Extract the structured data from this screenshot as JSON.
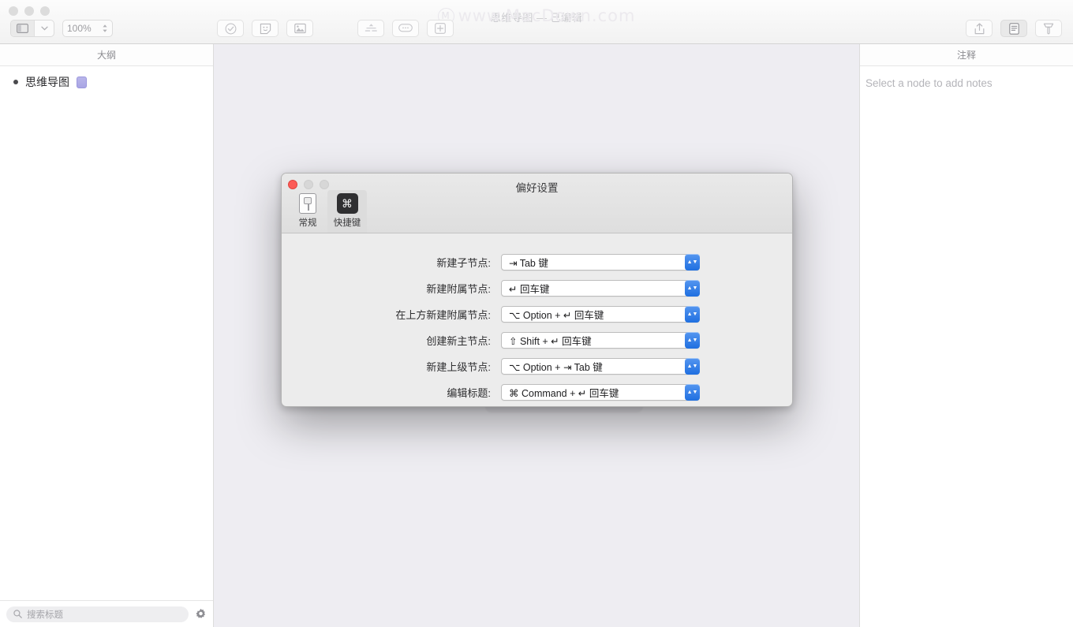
{
  "window": {
    "title": "思维导图 — 已编辑",
    "watermark": "www.MacDown.com",
    "traffic_lights": [
      "close",
      "minimize",
      "zoom"
    ]
  },
  "toolbar": {
    "zoom_level": "100%",
    "sidebar_toggle_icon": "sidebar-icon",
    "sidebar_dropdown_icon": "chevron-down-icon",
    "buttons": [
      {
        "name": "check-circle-icon",
        "label": "标记完成"
      },
      {
        "name": "sticker-icon",
        "label": "贴纸"
      },
      {
        "name": "image-icon",
        "label": "插入图片"
      },
      {
        "name": "boundary-icon",
        "label": "外框"
      },
      {
        "name": "comment-icon",
        "label": "备注"
      },
      {
        "name": "add-node-icon",
        "label": "新建节点"
      }
    ],
    "right_buttons": [
      {
        "name": "share-icon",
        "label": "共享",
        "active": false
      },
      {
        "name": "notes-panel-icon",
        "label": "注释面板",
        "active": true
      },
      {
        "name": "format-brush-icon",
        "label": "格式",
        "active": false
      }
    ]
  },
  "sidebar": {
    "header": "大纲",
    "items": [
      {
        "label": "思维导图",
        "emoji_icon": "sticker-badge-icon"
      }
    ],
    "search": {
      "placeholder": "搜索标题",
      "value": "",
      "icon": "search-icon"
    },
    "settings_icon": "gear-icon"
  },
  "notes_panel": {
    "header": "注释",
    "placeholder": "Select a node to add notes"
  },
  "preferences": {
    "title": "偏好设置",
    "tabs": [
      {
        "label": "常规",
        "icon": "general-switch-icon",
        "selected": false
      },
      {
        "label": "快捷键",
        "icon": "command-key-icon",
        "selected": true
      }
    ],
    "rows": [
      {
        "label": "新建子节点:",
        "key_glyph": "⇥",
        "value": "Tab 键",
        "full": "⇥ Tab 键"
      },
      {
        "label": "新建附属节点:",
        "key_glyph": "↵",
        "value": "回车键",
        "full": "↵ 回车键"
      },
      {
        "label": "在上方新建附属节点:",
        "key_glyph": "⌥",
        "value": "Option + ↵ 回车键",
        "full": "⌥ Option + ↵ 回车键"
      },
      {
        "label": "创建新主节点:",
        "key_glyph": "⇧",
        "value": "Shift + ↵ 回车键",
        "full": "⇧ Shift + ↵ 回车键"
      },
      {
        "label": "新建上级节点:",
        "key_glyph": "⌥",
        "value": "Option + ⇥ Tab 键",
        "full": "⌥ Option + ⇥ Tab 键"
      },
      {
        "label": "编辑标题:",
        "key_glyph": "⌘",
        "value": "Command + ↵ 回车键",
        "full": "⌘ Command + ↵ 回车键"
      }
    ]
  },
  "colors": {
    "accent_blue": "#2f7fe5",
    "canvas_bg": "#eeedf2",
    "dialog_bg": "#ececec",
    "close_red": "#fc5b57",
    "node_emoji": "#a9a5e4"
  }
}
